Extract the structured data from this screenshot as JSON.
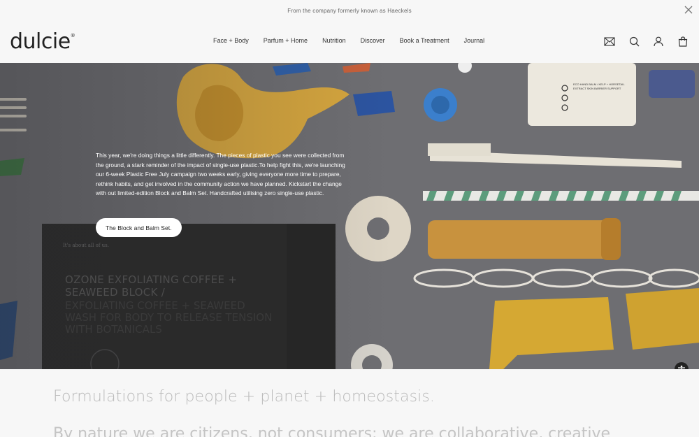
{
  "announcement": {
    "text": "From the company formerly known as Haeckels"
  },
  "brand": {
    "logo": "dulcie",
    "logo_mark": "®"
  },
  "nav": {
    "items": [
      {
        "label": "Face + Body"
      },
      {
        "label": "Parfum + Home"
      },
      {
        "label": "Nutrition"
      },
      {
        "label": "Discover"
      },
      {
        "label": "Book a Treatment"
      },
      {
        "label": "Journal"
      }
    ]
  },
  "header_icons": [
    "mail-icon",
    "search-icon",
    "account-icon",
    "bag-icon"
  ],
  "hero": {
    "body": "This year, we're doing things a little differently. The pieces of plastic you see were collected from the ground, a stark reminder of the impact of single-use plastic.To help fight this, we're launching our 6-week Plastic Free July campaign two weeks early, giving everyone more time to prepare, rethink habits, and get involved in the community action we have planned. Kickstart the change with out limited-edition Block and Balm Set. Handcrafted utilising zero single-use plastic.",
    "button_label": "The Block and Balm Set.",
    "box_small_text": "It's about all of us.",
    "box_title": "OZONE EXFOLIATING COFFEE + SEAWEED BLOCK /",
    "box_sub": "EXFOLIATING COFFEE + SEAWEED WASH FOR BODY TO RELEASE TENSION WITH BOTANICALS",
    "jar_label": "ECO HAND BALM / KELP + HORSETAIL EXTRACT SKIN BARRIER SUPPORT"
  },
  "lower": {
    "headline": "Formulations for people + planet + homeostasis.",
    "subline": "By nature we are citizens, not consumers; we are collaborative, creative"
  },
  "colors": {
    "background": "#f7f7f7",
    "hero_surface": "#6b6b6f",
    "button_bg": "#ffffff",
    "headline_text": "#b9b9b9"
  }
}
